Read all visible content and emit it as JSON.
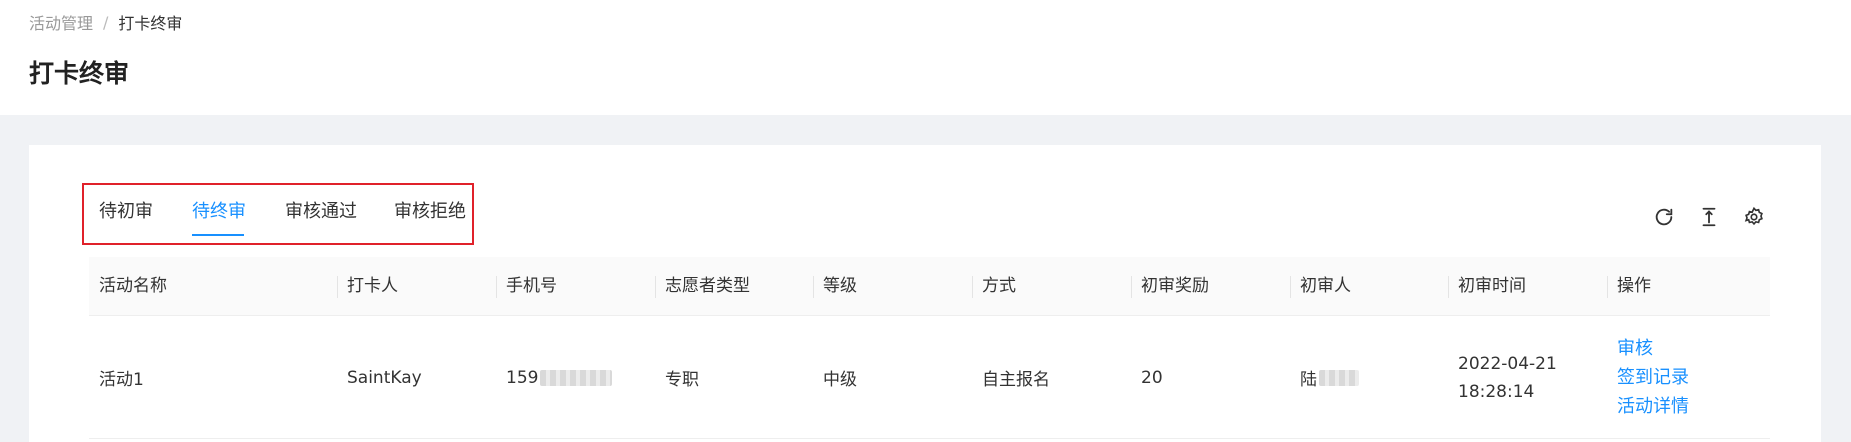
{
  "breadcrumb": {
    "parent": "活动管理",
    "separator": "/",
    "current": "打卡终审"
  },
  "page": {
    "title": "打卡终审"
  },
  "tabs": [
    {
      "label": "待初审"
    },
    {
      "label": "待终审"
    },
    {
      "label": "审核通过"
    },
    {
      "label": "审核拒绝"
    }
  ],
  "active_tab_index": 1,
  "toolbar": {
    "icons": [
      "refresh-icon",
      "column-height-icon",
      "settings-icon"
    ]
  },
  "table": {
    "columns": [
      "活动名称",
      "打卡人",
      "手机号",
      "志愿者类型",
      "等级",
      "方式",
      "初审奖励",
      "初审人",
      "初审时间",
      "操作"
    ],
    "rows": [
      {
        "activity": "活动1",
        "checker": "SaintKay",
        "phone_prefix": "159",
        "volunteer_type": "专职",
        "level": "中级",
        "method": "自主报名",
        "reward": "20",
        "reviewer_prefix": "陆",
        "date": "2022-04-21",
        "time": "18:28:14",
        "actions": [
          "审核",
          "签到记录",
          "活动详情"
        ]
      }
    ]
  },
  "colors": {
    "accent": "#1890ff",
    "highlight_border": "#e0212a"
  }
}
